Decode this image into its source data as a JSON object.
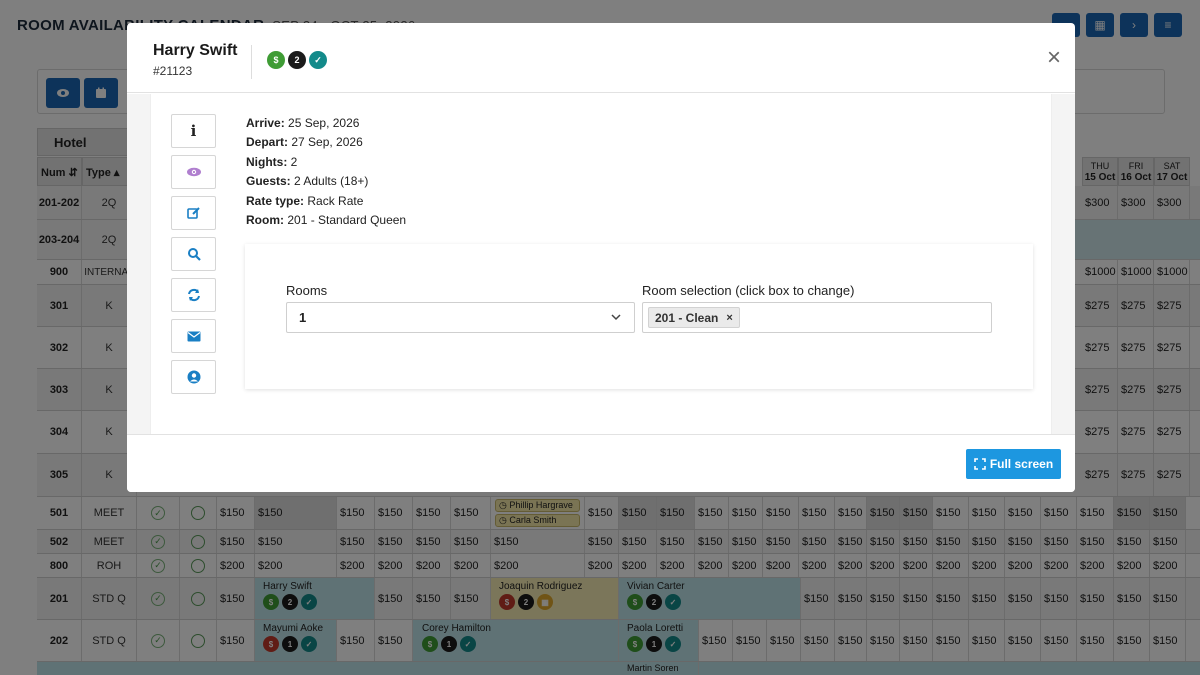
{
  "page": {
    "title": "ROOM AVAILABILITY CALENDAR",
    "range": "SEP 24 - OCT 25, 2026"
  },
  "grid": {
    "hotel_label": "Hotel",
    "col_num": "Num",
    "col_type": "Type",
    "date_headers": [
      {
        "dow": "THU",
        "date": "15 Oct"
      },
      {
        "dow": "FRI",
        "date": "16 Oct"
      },
      {
        "dow": "SAT",
        "date": "17 Oct"
      }
    ],
    "rows_top": [
      {
        "num": "201-202",
        "type": "2Q",
        "rates": [
          "$300",
          "$300",
          "$300"
        ]
      },
      {
        "num": "203-204",
        "type": "2Q",
        "rates": [
          "",
          "",
          ""
        ]
      },
      {
        "num": "900",
        "type": "INTERNAL",
        "rates": [
          "$1000",
          "$1000",
          "$1000"
        ]
      },
      {
        "num": "301",
        "type": "K",
        "rates": [
          "$275",
          "$275",
          "$275"
        ]
      },
      {
        "num": "302",
        "type": "K",
        "rates": [
          "$275",
          "$275",
          "$275"
        ]
      },
      {
        "num": "303",
        "type": "K",
        "rates": [
          "$275",
          "$275",
          "$275"
        ]
      },
      {
        "num": "304",
        "type": "K",
        "rates": [
          "$275",
          "$275",
          "$275"
        ]
      },
      {
        "num": "305",
        "type": "K",
        "rates": [
          "$275",
          "$275",
          "$275"
        ]
      }
    ],
    "rows_bottom": [
      {
        "num": "501",
        "type": "MEET",
        "rate": "$150"
      },
      {
        "num": "502",
        "type": "MEET",
        "rate": "$150"
      },
      {
        "num": "800",
        "type": "ROH",
        "rate": "$200"
      },
      {
        "num": "201",
        "type": "STD Q",
        "rate": "$150"
      },
      {
        "num": "202",
        "type": "STD Q",
        "rate": "$150"
      }
    ],
    "bookings": {
      "harry": "Harry Swift",
      "joaquin": "Joaquin Rodriguez",
      "vivian": "Vivian Carter",
      "mayumi": "Mayumi Aoke",
      "corey": "Corey Hamilton",
      "paola": "Paola Loretti",
      "martin": "Martin Soren",
      "phillip": "Phillip Hargrave",
      "carla": "Carla Smith"
    }
  },
  "modal": {
    "guest_name": "Harry Swift",
    "guest_id": "#21123",
    "status_icons": [
      {
        "name": "paid-icon",
        "glyph": "$",
        "color": "#3f9c35"
      },
      {
        "name": "guest-count-icon",
        "glyph": "2",
        "color": "#1b1b1b"
      },
      {
        "name": "confirmed-icon",
        "glyph": "✓",
        "color": "#138a8a"
      }
    ],
    "close_label": "×",
    "details": {
      "arrive_label": "Arrive:",
      "arrive": "25 Sep, 2026",
      "depart_label": "Depart:",
      "depart": "27 Sep, 2026",
      "nights_label": "Nights:",
      "nights": "2",
      "guests_label": "Guests:",
      "guests": "2 Adults (18+)",
      "rate_label": "Rate type:",
      "rate": "Rack Rate",
      "room_label": "Room:",
      "room": "201 - Standard Queen"
    },
    "rooms_label": "Rooms",
    "rooms_value": "1",
    "room_selection_label": "Room selection (click box to change)",
    "selected_room": "201 - Clean",
    "selected_remove": "×",
    "fullscreen_label": "Full screen"
  }
}
